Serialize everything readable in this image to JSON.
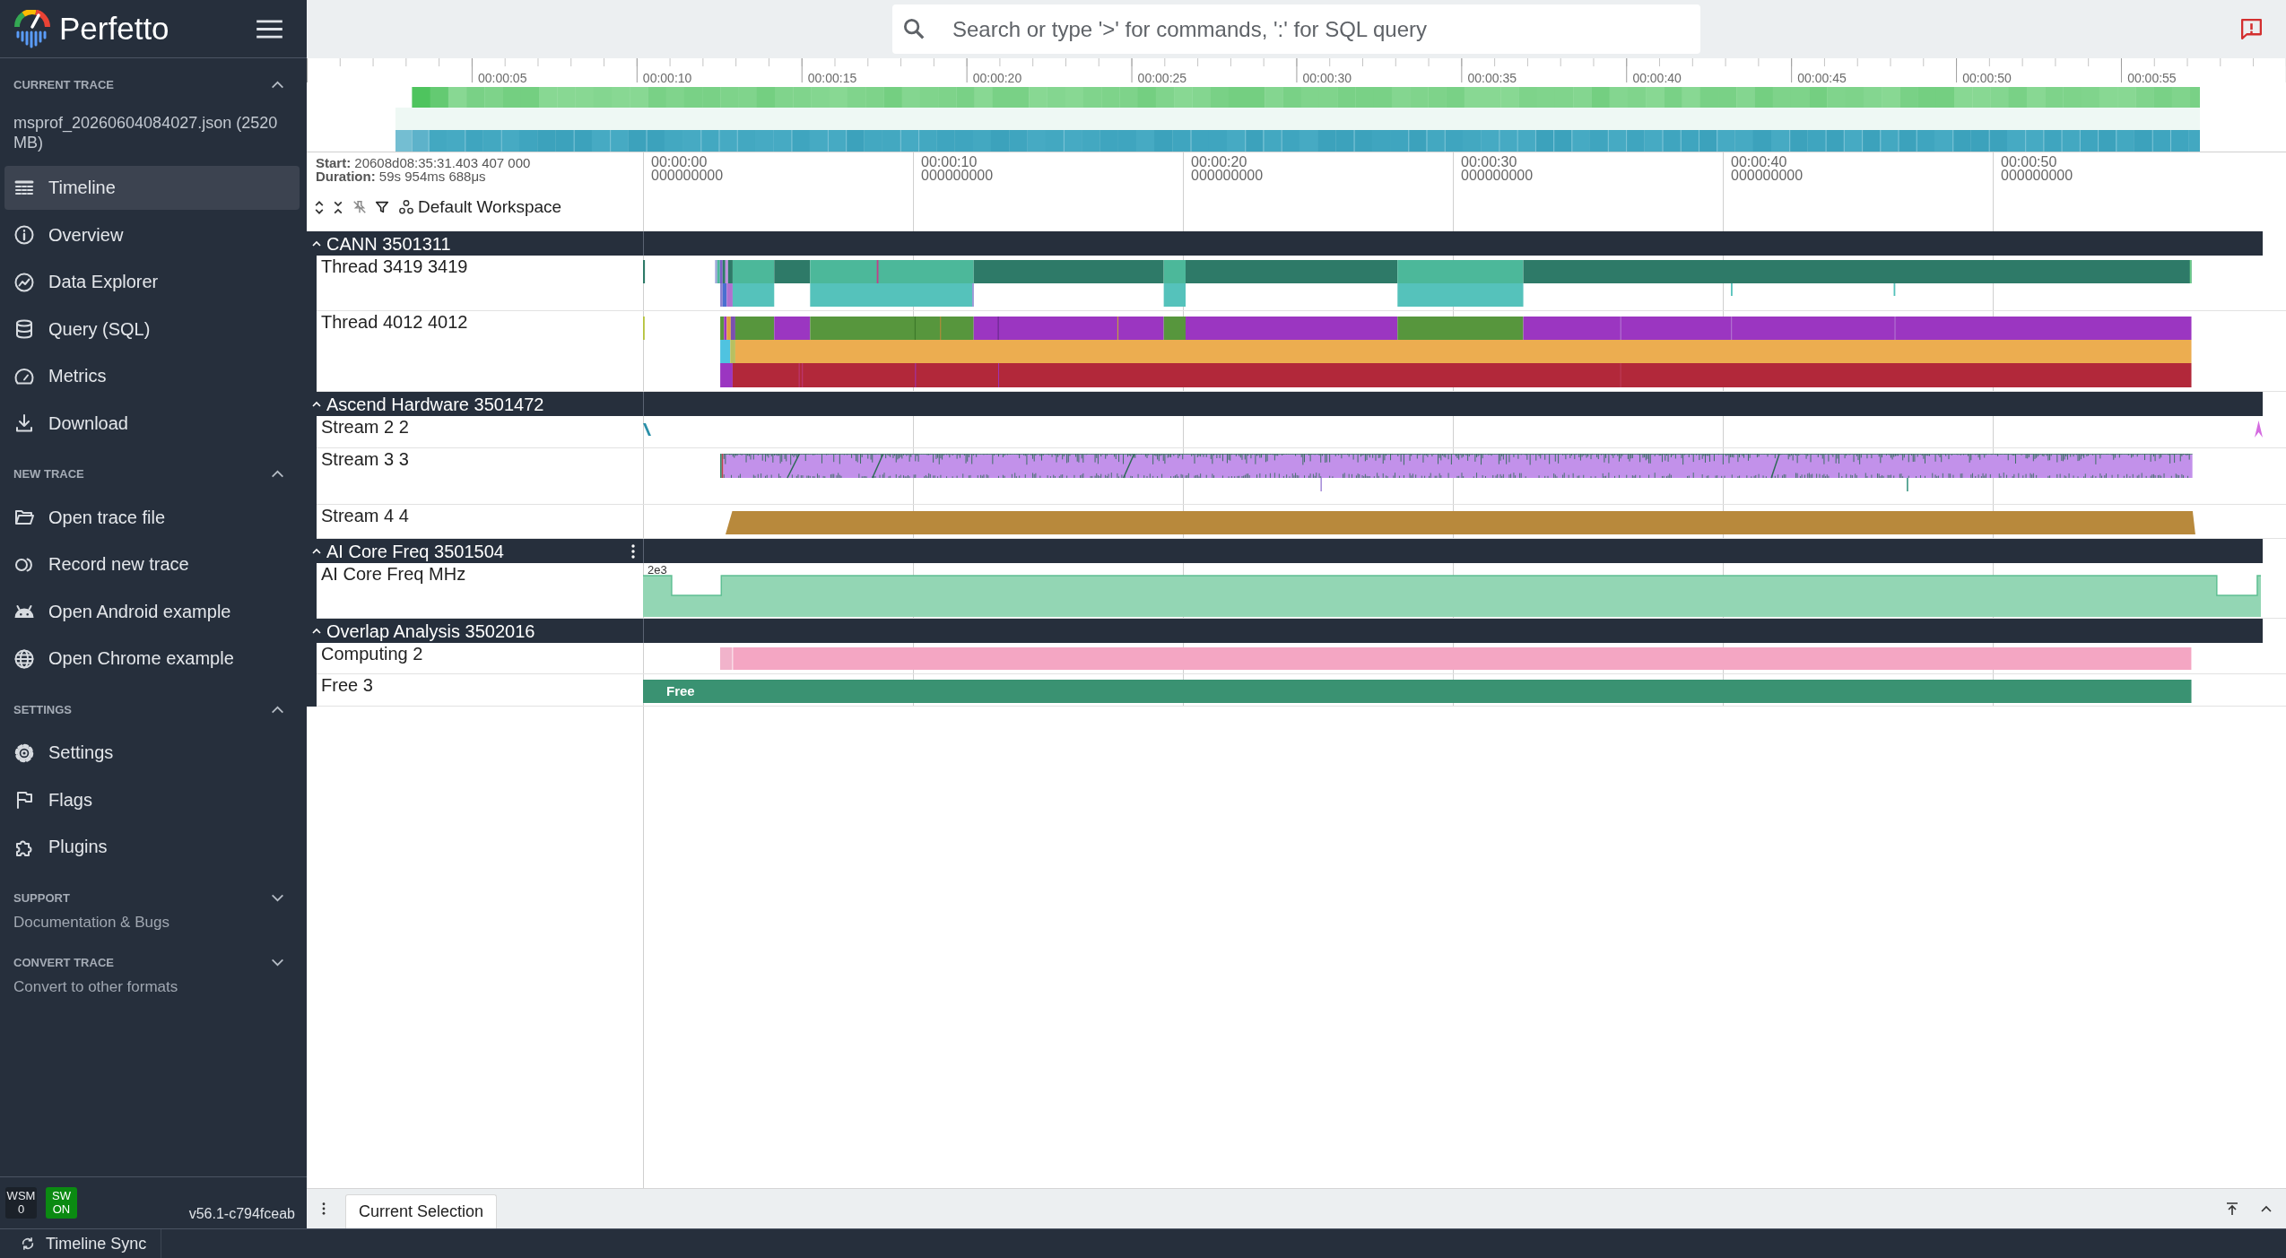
{
  "sidebar": {
    "logo": "Perfetto",
    "sections": [
      {
        "title": "CURRENT TRACE",
        "expanded": true,
        "trace_name": "msprof_20260604084027.json (2520 MB)",
        "items": [
          {
            "label": "Timeline",
            "selected": true
          },
          {
            "label": "Overview",
            "selected": false
          },
          {
            "label": "Data Explorer",
            "selected": false
          },
          {
            "label": "Query (SQL)",
            "selected": false
          },
          {
            "label": "Metrics",
            "selected": false
          },
          {
            "label": "Download",
            "selected": false
          }
        ]
      },
      {
        "title": "NEW TRACE",
        "expanded": true,
        "items": [
          {
            "label": "Open trace file",
            "selected": false
          },
          {
            "label": "Record new trace",
            "selected": false
          },
          {
            "label": "Open Android example",
            "selected": false
          },
          {
            "label": "Open Chrome example",
            "selected": false
          }
        ]
      },
      {
        "title": "SETTINGS",
        "expanded": true,
        "items": [
          {
            "label": "Settings",
            "selected": false
          },
          {
            "label": "Flags",
            "selected": false
          },
          {
            "label": "Plugins",
            "selected": false
          }
        ]
      },
      {
        "title": "SUPPORT",
        "expanded": false,
        "summary": "Documentation & Bugs"
      },
      {
        "title": "CONVERT TRACE",
        "expanded": false,
        "summary": "Convert to other formats"
      }
    ],
    "status": [
      {
        "label": "WSM",
        "value": "0",
        "on": false
      },
      {
        "label": "SW",
        "value": "ON",
        "on": true
      }
    ],
    "version": "v56.1-c794fceab"
  },
  "topbar": {
    "search": {
      "placeholder": "Search or type '>' for commands, ':' for SQL query"
    }
  },
  "overview": {
    "ticks": [
      "00:00:05",
      "00:00:10",
      "00:00:15",
      "00:00:20",
      "00:00:25",
      "00:00:30",
      "00:00:35",
      "00:00:40",
      "00:00:45",
      "00:00:50",
      "00:00:55"
    ]
  },
  "timeline": {
    "start": "**Start:** 20608d08:35:31.403 407 000",
    "duration": "**Duration:** 59s 954ms 688μs",
    "workspace": "Default Workspace",
    "ticks": [
      {
        "time": "00:00:00",
        "ns": "000000000"
      },
      {
        "time": "00:00:10",
        "ns": "000000000"
      },
      {
        "time": "00:00:20",
        "ns": "000000000"
      },
      {
        "time": "00:00:30",
        "ns": "000000000"
      },
      {
        "time": "00:00:40",
        "ns": "000000000"
      },
      {
        "time": "00:00:50",
        "ns": "000000000"
      }
    ],
    "groups": [
      {
        "name": "CANN 3501311",
        "expanded": true,
        "hovered": false,
        "tracks": [
          {
            "name": "Thread 3419 3419",
            "kind": "slices"
          },
          {
            "name": "Thread 4012 4012",
            "kind": "slices"
          }
        ]
      },
      {
        "name": "Ascend Hardware 3501472",
        "expanded": true,
        "hovered": false,
        "tracks": [
          {
            "name": "Stream 2 2",
            "kind": "slices"
          },
          {
            "name": "Stream 3 3",
            "kind": "slices"
          },
          {
            "name": "Stream 4 4",
            "kind": "slices"
          }
        ]
      },
      {
        "name": "AI Core Freq 3501504",
        "expanded": true,
        "hovered": true,
        "tracks": [
          {
            "name": "AI Core Freq MHz",
            "kind": "counter",
            "scale_label": "2e3"
          }
        ]
      },
      {
        "name": "Overlap Analysis 3502016",
        "expanded": true,
        "hovered": false,
        "tracks": [
          {
            "name": "Computing 2",
            "kind": "slices"
          },
          {
            "name": "Free 3",
            "kind": "slices",
            "slice_label": "Free"
          }
        ]
      }
    ]
  },
  "bottom_panel": {
    "tabs": [
      {
        "label": "Current Selection",
        "selected": true
      }
    ]
  },
  "status_bar": {
    "sync_button": "Timeline Sync"
  }
}
